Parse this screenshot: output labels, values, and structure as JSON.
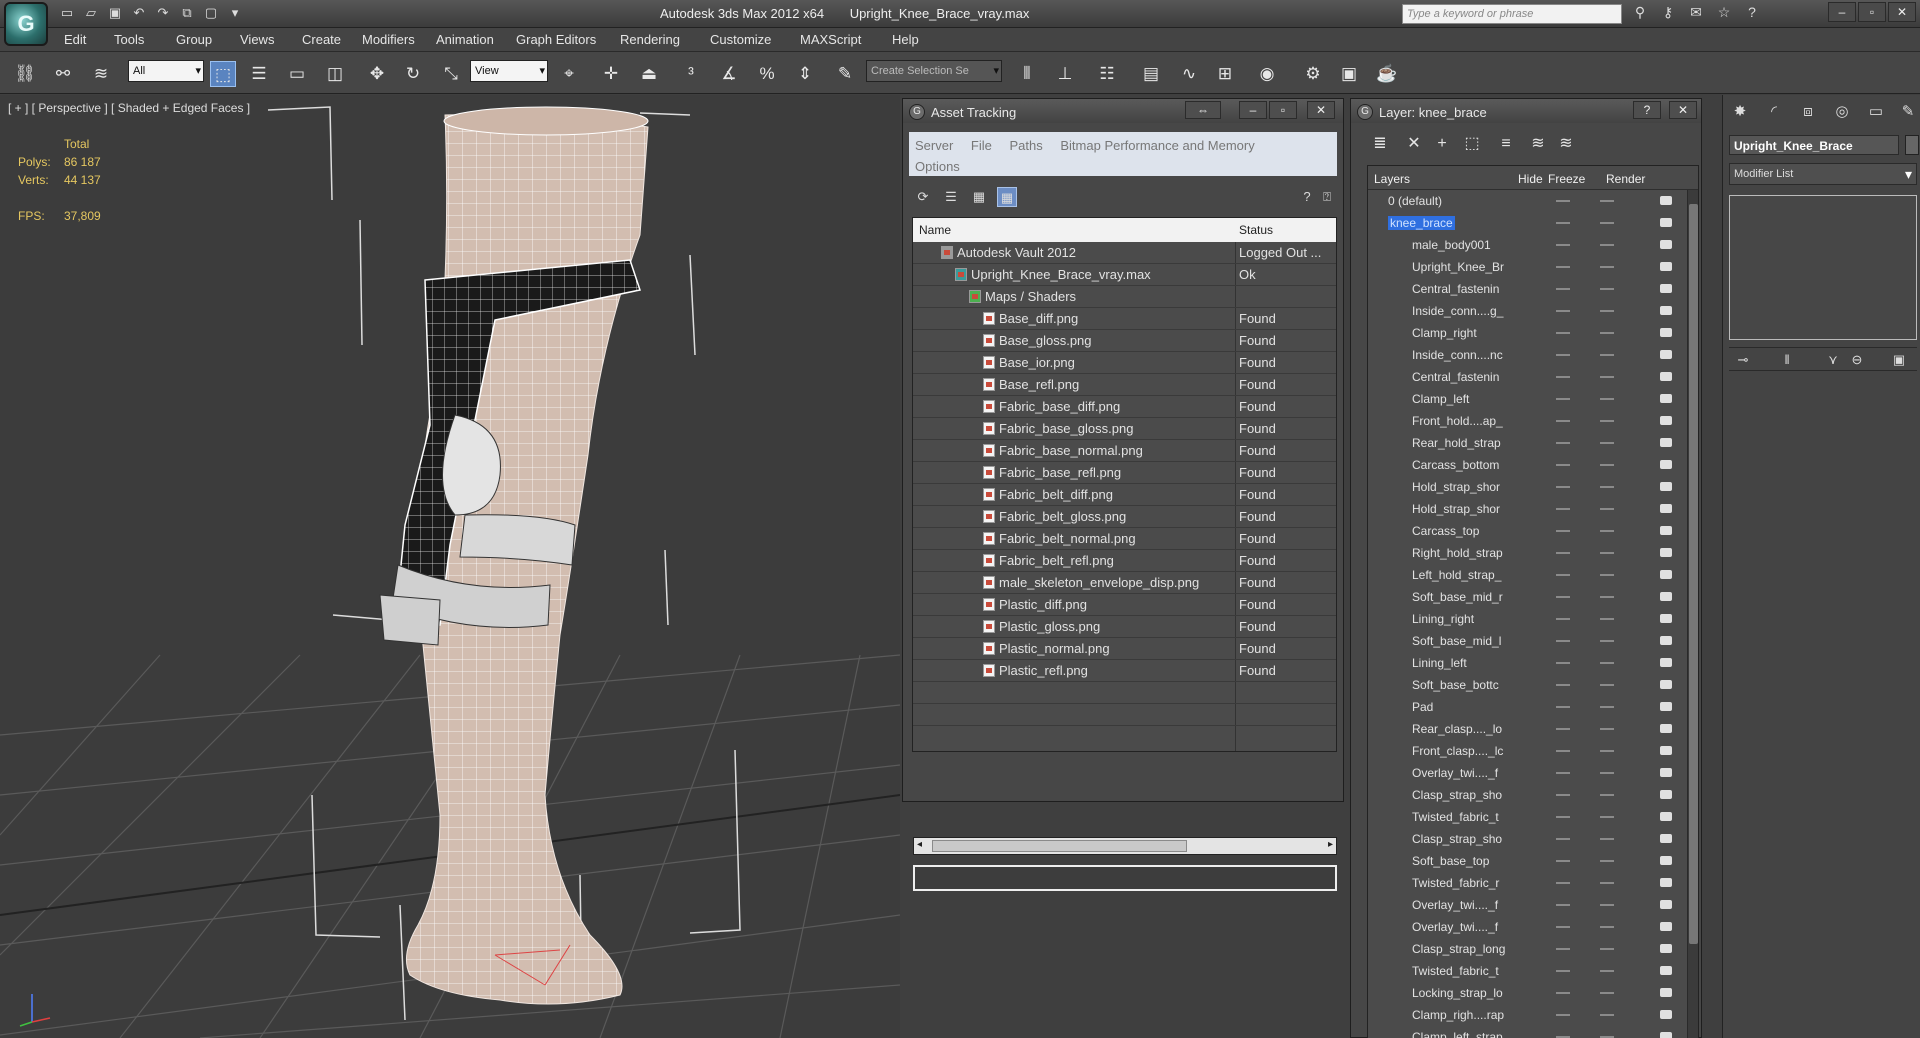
{
  "app": {
    "logo_glyph": "G",
    "title": "Autodesk 3ds Max  2012 x64",
    "filename": "Upright_Knee_Brace_vray.max",
    "search_placeholder": "Type a keyword or phrase"
  },
  "menu": [
    "Edit",
    "Tools",
    "Group",
    "Views",
    "Create",
    "Modifiers",
    "Animation",
    "Graph Editors",
    "Rendering",
    "Customize",
    "MAXScript",
    "Help"
  ],
  "toolbar": {
    "selection_filter": "All",
    "ref_coord": "View",
    "named_selection": "Create Selection Se"
  },
  "viewport": {
    "label": "[ + ] [ Perspective ] [ Shaded + Edged Faces ]",
    "stats_header": "Total",
    "polys_label": "Polys:",
    "polys_value": "86 187",
    "verts_label": "Verts:",
    "verts_value": "44 137",
    "fps_label": "FPS:",
    "fps_value": "37,809"
  },
  "asset_tracking": {
    "title": "Asset Tracking",
    "menu": [
      "Server",
      "File",
      "Paths",
      "Bitmap Performance and Memory",
      "Options"
    ],
    "col_name": "Name",
    "col_status": "Status",
    "rows": [
      {
        "name": "Autodesk Vault 2012",
        "status": "Logged Out ...",
        "indent": 1,
        "icon": "vault"
      },
      {
        "name": "Upright_Knee_Brace_vray.max",
        "status": "Ok",
        "indent": 2,
        "icon": "max"
      },
      {
        "name": "Maps / Shaders",
        "status": "",
        "indent": 3,
        "icon": "maps"
      },
      {
        "name": "Base_diff.png",
        "status": "Found",
        "indent": 4,
        "icon": "file"
      },
      {
        "name": "Base_gloss.png",
        "status": "Found",
        "indent": 4,
        "icon": "file"
      },
      {
        "name": "Base_ior.png",
        "status": "Found",
        "indent": 4,
        "icon": "file"
      },
      {
        "name": "Base_refl.png",
        "status": "Found",
        "indent": 4,
        "icon": "file"
      },
      {
        "name": "Fabric_base_diff.png",
        "status": "Found",
        "indent": 4,
        "icon": "file"
      },
      {
        "name": "Fabric_base_gloss.png",
        "status": "Found",
        "indent": 4,
        "icon": "file"
      },
      {
        "name": "Fabric_base_normal.png",
        "status": "Found",
        "indent": 4,
        "icon": "file"
      },
      {
        "name": "Fabric_base_refl.png",
        "status": "Found",
        "indent": 4,
        "icon": "file"
      },
      {
        "name": "Fabric_belt_diff.png",
        "status": "Found",
        "indent": 4,
        "icon": "file"
      },
      {
        "name": "Fabric_belt_gloss.png",
        "status": "Found",
        "indent": 4,
        "icon": "file"
      },
      {
        "name": "Fabric_belt_normal.png",
        "status": "Found",
        "indent": 4,
        "icon": "file"
      },
      {
        "name": "Fabric_belt_refl.png",
        "status": "Found",
        "indent": 4,
        "icon": "file"
      },
      {
        "name": "male_skeleton_envelope_disp.png",
        "status": "Found",
        "indent": 4,
        "icon": "file"
      },
      {
        "name": "Plastic_diff.png",
        "status": "Found",
        "indent": 4,
        "icon": "file"
      },
      {
        "name": "Plastic_gloss.png",
        "status": "Found",
        "indent": 4,
        "icon": "file"
      },
      {
        "name": "Plastic_normal.png",
        "status": "Found",
        "indent": 4,
        "icon": "file"
      },
      {
        "name": "Plastic_refl.png",
        "status": "Found",
        "indent": 4,
        "icon": "file"
      }
    ]
  },
  "layer_panel": {
    "title": "Layer: knee_brace",
    "col_layers": "Layers",
    "col_hide": "Hide",
    "col_freeze": "Freeze",
    "col_render": "Render",
    "rows": [
      {
        "name": "0 (default)",
        "level": 0,
        "selected": false
      },
      {
        "name": "knee_brace",
        "level": 0,
        "selected": true
      },
      {
        "name": "male_body001",
        "level": 1
      },
      {
        "name": "Upright_Knee_Br",
        "level": 1
      },
      {
        "name": "Central_fastenin",
        "level": 1
      },
      {
        "name": "Inside_conn....g_",
        "level": 1
      },
      {
        "name": "Clamp_right",
        "level": 1
      },
      {
        "name": "Inside_conn....nc",
        "level": 1
      },
      {
        "name": "Central_fastenin",
        "level": 1
      },
      {
        "name": "Clamp_left",
        "level": 1
      },
      {
        "name": "Front_hold....ap_",
        "level": 1
      },
      {
        "name": "Rear_hold_strap",
        "level": 1
      },
      {
        "name": "Carcass_bottom",
        "level": 1
      },
      {
        "name": "Hold_strap_shor",
        "level": 1
      },
      {
        "name": "Hold_strap_shor",
        "level": 1
      },
      {
        "name": "Carcass_top",
        "level": 1
      },
      {
        "name": "Right_hold_strap",
        "level": 1
      },
      {
        "name": "Left_hold_strap_",
        "level": 1
      },
      {
        "name": "Soft_base_mid_r",
        "level": 1
      },
      {
        "name": "Lining_right",
        "level": 1
      },
      {
        "name": "Soft_base_mid_l",
        "level": 1
      },
      {
        "name": "Lining_left",
        "level": 1
      },
      {
        "name": "Soft_base_bottc",
        "level": 1
      },
      {
        "name": "Pad",
        "level": 1
      },
      {
        "name": "Rear_clasp...._lo",
        "level": 1
      },
      {
        "name": "Front_clasp...._lc",
        "level": 1
      },
      {
        "name": "Overlay_twi...._f",
        "level": 1
      },
      {
        "name": "Clasp_strap_sho",
        "level": 1
      },
      {
        "name": "Twisted_fabric_t",
        "level": 1
      },
      {
        "name": "Clasp_strap_sho",
        "level": 1
      },
      {
        "name": "Soft_base_top",
        "level": 1
      },
      {
        "name": "Twisted_fabric_r",
        "level": 1
      },
      {
        "name": "Overlay_twi...._f",
        "level": 1
      },
      {
        "name": "Overlay_twi...._f",
        "level": 1
      },
      {
        "name": "Clasp_strap_long",
        "level": 1
      },
      {
        "name": "Twisted_fabric_t",
        "level": 1
      },
      {
        "name": "Locking_strap_lo",
        "level": 1
      },
      {
        "name": "Clamp_righ....rap",
        "level": 1
      },
      {
        "name": "Clamp_left_strap",
        "level": 1
      }
    ]
  },
  "command_panel": {
    "object_name": "Upright_Knee_Brace",
    "modifier_list": "Modifier List"
  },
  "colors": {
    "selection_blue": "#2f6fe0",
    "stats_yellow": "#e5c760",
    "highlight_tab": "#5a84c0"
  }
}
